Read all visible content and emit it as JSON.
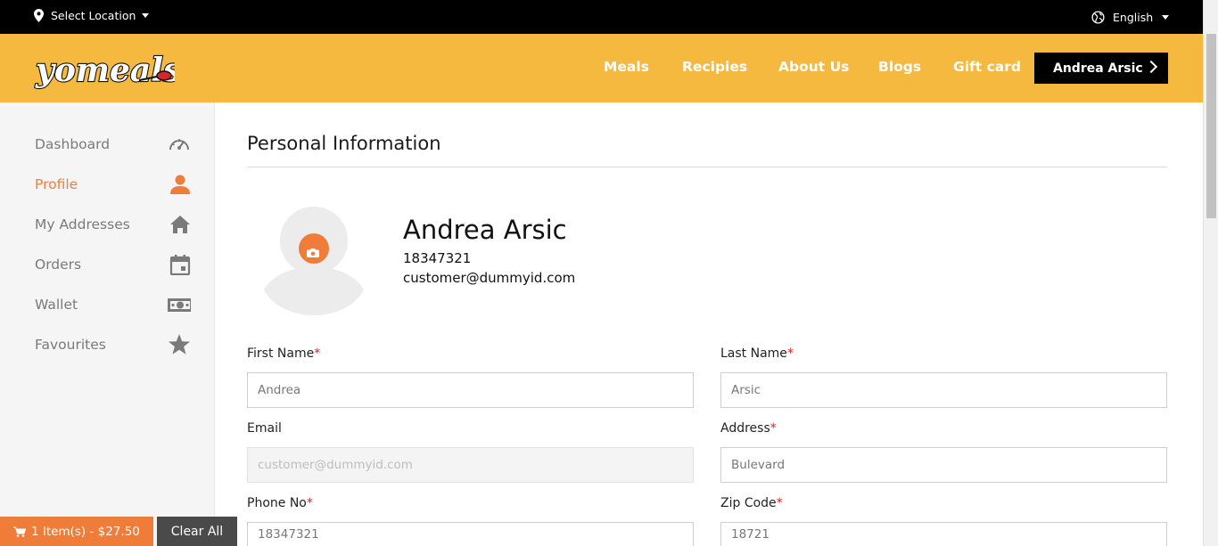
{
  "topbar": {
    "location_label": "Select Location",
    "language_label": "English"
  },
  "header": {
    "logo_text": "yomeals",
    "nav": [
      "Meals",
      "Recipies",
      "About Us",
      "Blogs",
      "Gift card"
    ],
    "user_button": "Andrea Arsic"
  },
  "sidebar": {
    "items": [
      {
        "label": "Dashboard",
        "icon": "speedometer-icon",
        "active": false
      },
      {
        "label": "Profile",
        "icon": "user-icon",
        "active": true
      },
      {
        "label": "My Addresses",
        "icon": "home-icon",
        "active": false
      },
      {
        "label": "Orders",
        "icon": "calendar-icon",
        "active": false
      },
      {
        "label": "Wallet",
        "icon": "money-icon",
        "active": false
      },
      {
        "label": "Favourites",
        "icon": "star-icon",
        "active": false
      }
    ]
  },
  "main": {
    "title": "Personal Information",
    "profile": {
      "name": "Andrea Arsic",
      "phone": "18347321",
      "email": "customer@dummyid.com"
    },
    "form": {
      "first_name": {
        "label": "First Name",
        "required": "*",
        "value": "Andrea"
      },
      "last_name": {
        "label": "Last Name",
        "required": "*",
        "value": "Arsic"
      },
      "email": {
        "label": "Email",
        "value": "customer@dummyid.com"
      },
      "address": {
        "label": "Address",
        "required": "*",
        "value": "Bulevard"
      },
      "phone": {
        "label": "Phone No",
        "required": "*",
        "value": "18347321"
      },
      "zip": {
        "label": "Zip Code",
        "required": "*",
        "value": "18721"
      }
    }
  },
  "cart": {
    "summary": "1 Item(s) - $27.50",
    "clear_label": "Clear All"
  },
  "colors": {
    "brand_yellow": "#f5b93f",
    "accent_orange": "#f07c3a",
    "topbar": "#000000"
  }
}
